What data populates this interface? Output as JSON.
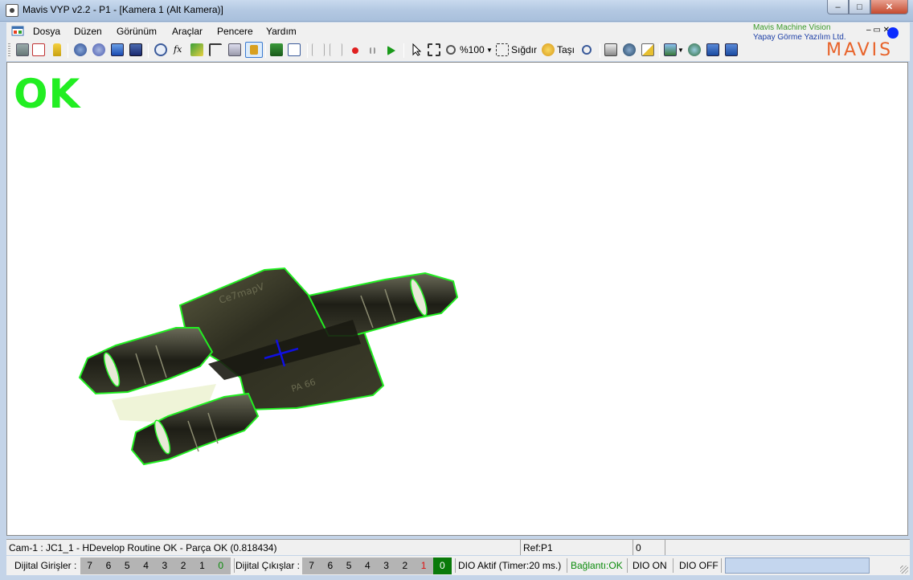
{
  "window": {
    "title": "Mavis VYP v2.2 - P1 - [Kamera 1 (Alt Kamera)]",
    "minimize_glyph": "–",
    "maximize_glyph": "□",
    "close_glyph": "✕"
  },
  "menu": {
    "items": [
      "Dosya",
      "Düzen",
      "Görünüm",
      "Araçlar",
      "Pencere",
      "Yardım"
    ]
  },
  "toolbar": {
    "zoom_label": "%100",
    "fit_label": "Sığdır",
    "move_label": "Taşı"
  },
  "logo": {
    "line1": "Mavis Machine Vision",
    "line2": "Yapay Görme Yazılım Ltd.",
    "brand": "MAVIS",
    "mdi_controls": "–  ▭ ✕"
  },
  "inspection": {
    "result": "OK",
    "result_color": "#22ee22",
    "contour_color": "#22ee22",
    "cross_color": "#1010e0",
    "part_text_1": "Ce7mapV",
    "part_text_2": "PA 66"
  },
  "status": {
    "message": "Cam-1 : JC1_1 - HDevelop Routine OK - Parça OK (0.818434)",
    "ref": "Ref:P1",
    "value": "0"
  },
  "dio": {
    "inputs_label": "Dijital Girişler :",
    "inputs": [
      "7",
      "6",
      "5",
      "4",
      "3",
      "2",
      "1",
      "0"
    ],
    "outputs_label": "Dijital Çıkışlar :",
    "outputs": [
      "7",
      "6",
      "5",
      "4",
      "3",
      "2",
      "1",
      "0"
    ],
    "dio_active": "DIO Aktif (Timer:20 ms.)",
    "connection": "Bağlantı:OK",
    "dio_on": "DIO ON",
    "dio_off": "DIO OFF"
  }
}
